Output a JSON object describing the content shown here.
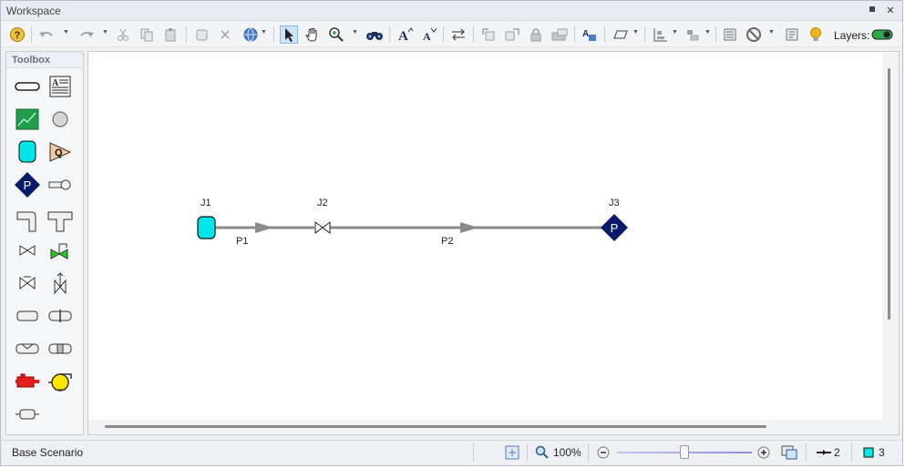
{
  "window": {
    "title": "Workspace",
    "pin_glyph": "▪",
    "close_glyph": "✕"
  },
  "toolbar": {
    "icons": [
      "help-icon",
      "undo-icon",
      "redo-icon",
      "cut-icon",
      "copy-icon",
      "paste-icon",
      "duplicate-icon",
      "delete-icon",
      "globe-icon",
      "select-arrow-icon",
      "pan-hand-icon",
      "zoom-icon",
      "find-binoculars-icon",
      "font-larger-icon",
      "font-smaller-icon",
      "reverse-icon",
      "align-icon",
      "group-icon",
      "lock-icon",
      "hide-icon",
      "annotate-icon",
      "shape-icon",
      "arrange-icon",
      "distribute-icon",
      "properties-icon",
      "disable-icon",
      "view-icon",
      "tips-bulb-icon"
    ],
    "layers_label": "Layers:",
    "layers_toggle_on": true
  },
  "toolbox": {
    "title": "Toolbox",
    "items": [
      "pipe",
      "annotation",
      "graph",
      "junction",
      "reservoir",
      "flow-control",
      "pressure-junction",
      "spray",
      "bend",
      "tee",
      "valve",
      "control-valve",
      "check-valve",
      "relief-valve",
      "heat-exchanger",
      "orifice",
      "filter",
      "strainer",
      "volume-balance",
      "pump",
      "compressor"
    ]
  },
  "model": {
    "junctions": [
      {
        "id": "J1",
        "type": "reservoir",
        "color": "#00e5e5"
      },
      {
        "id": "J2",
        "type": "valve",
        "color": "#ffffff"
      },
      {
        "id": "J3",
        "type": "assigned-pressure",
        "color": "#0a1a6b",
        "symbol": "P"
      }
    ],
    "pipes": [
      {
        "id": "P1",
        "from": "J1",
        "to": "J2"
      },
      {
        "id": "P2",
        "from": "J2",
        "to": "J3"
      }
    ],
    "pipe_color": "#8a8a8a"
  },
  "status": {
    "scenario": "Base Scenario",
    "zoom": "100%",
    "zoom_fraction": 0.5,
    "pipe_count": "2",
    "junction_count": "3"
  }
}
